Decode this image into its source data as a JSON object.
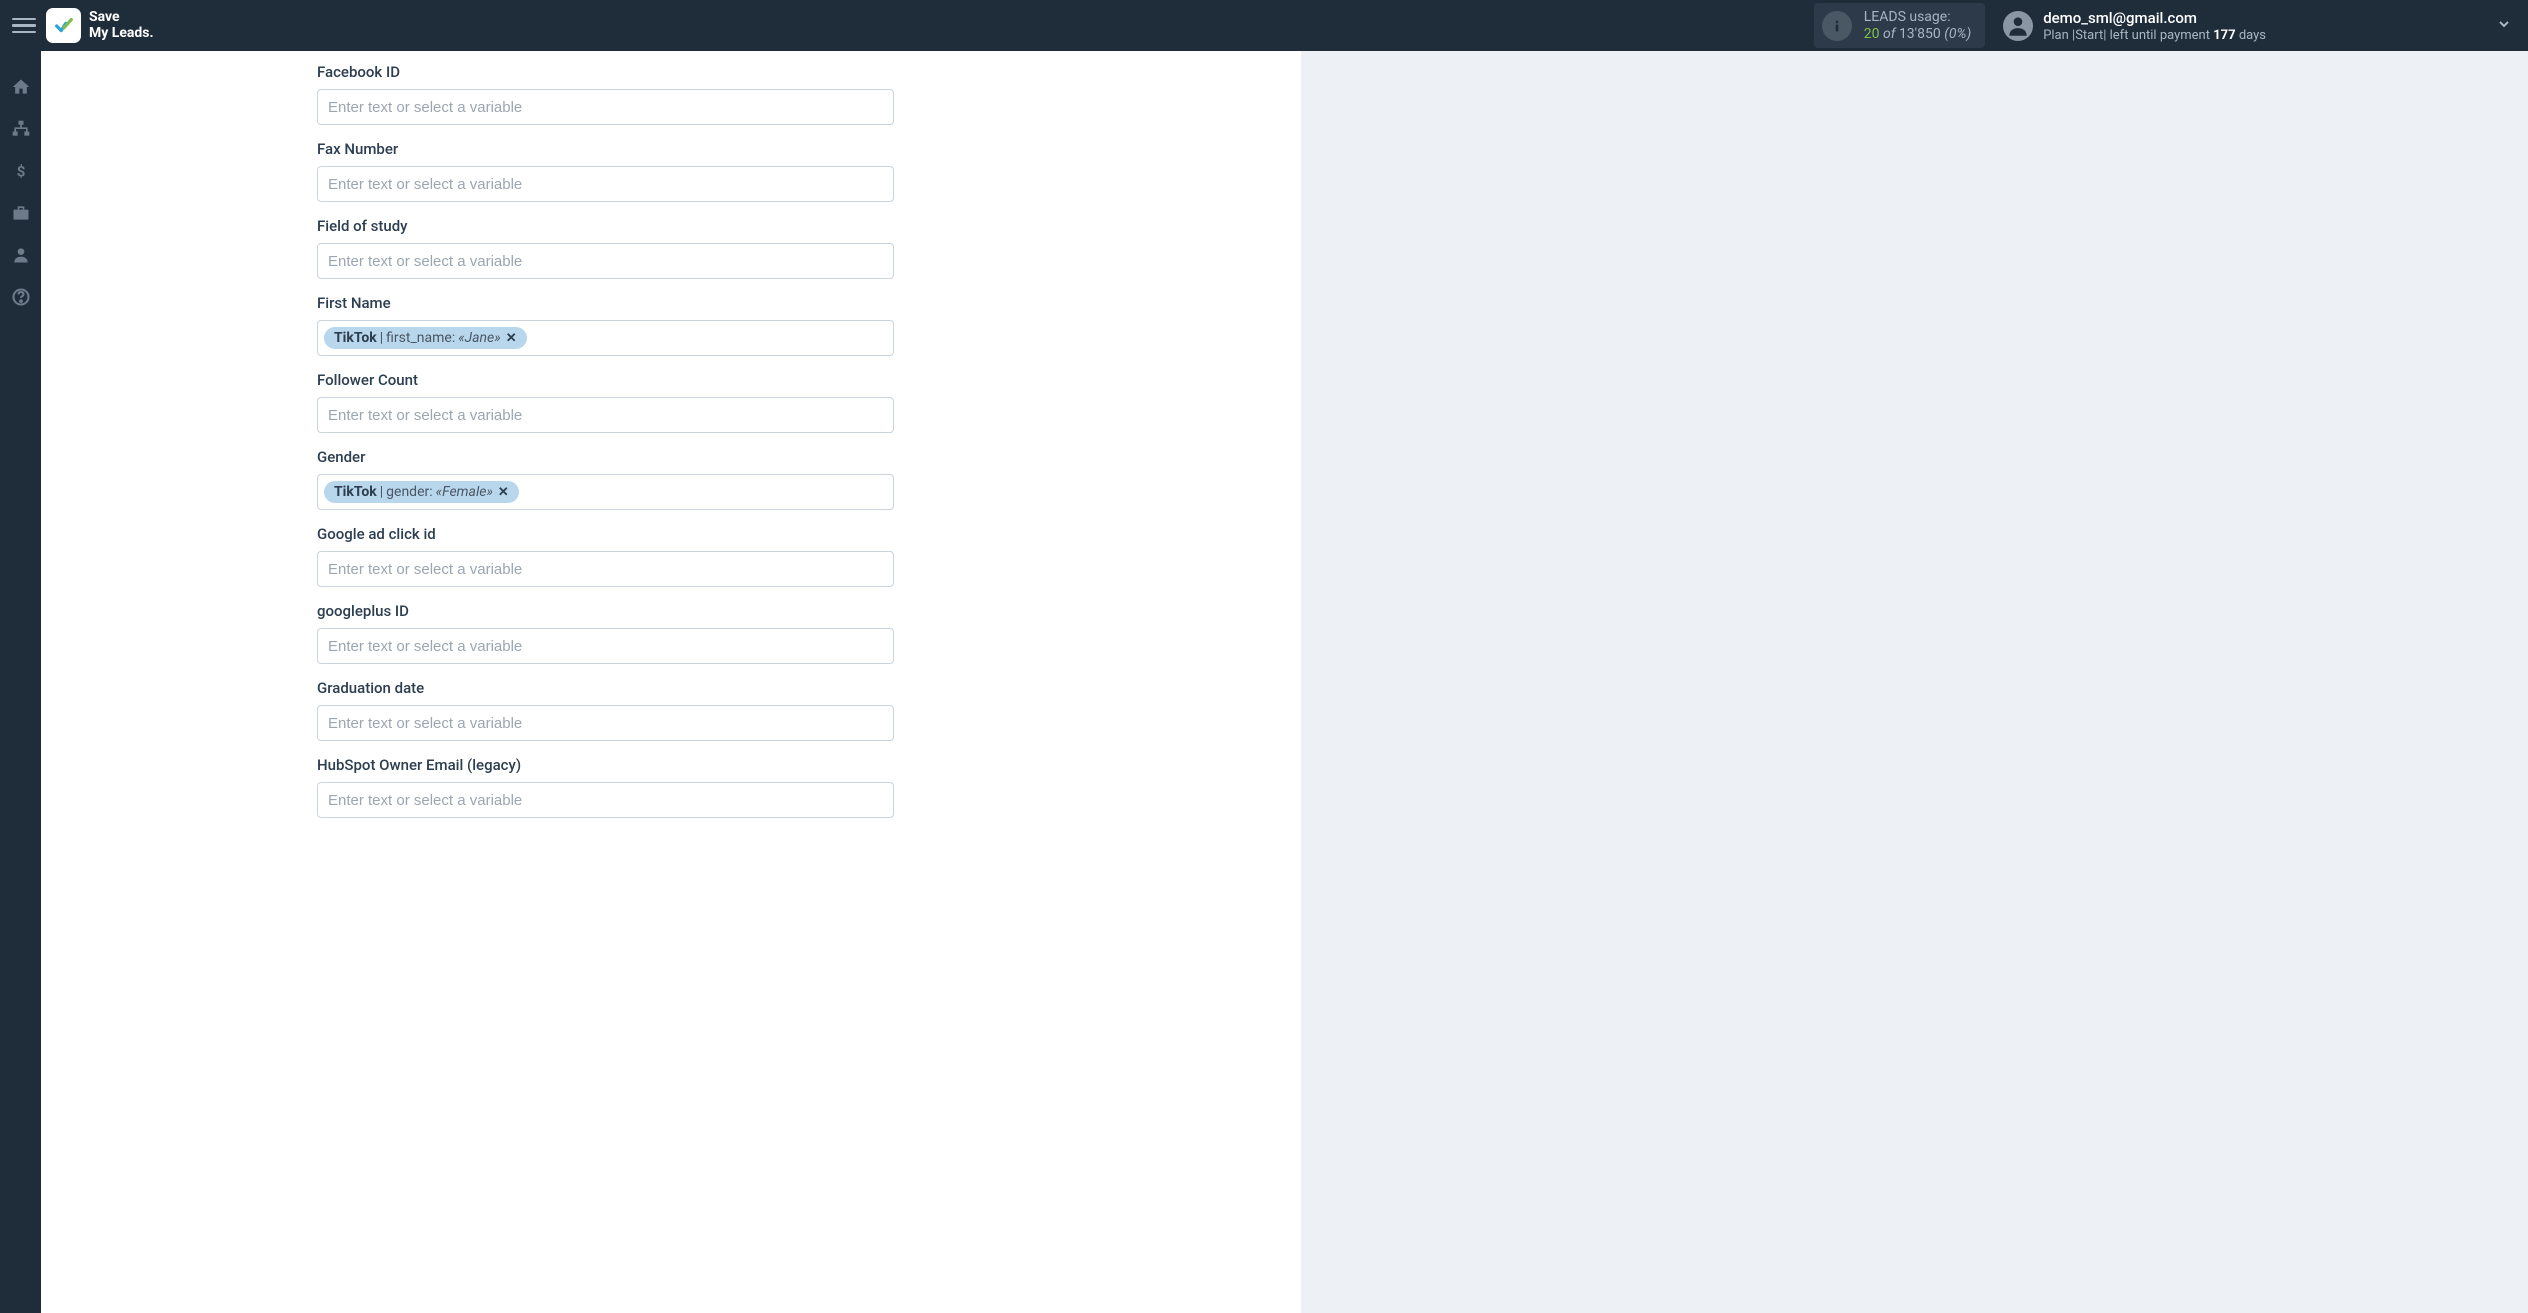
{
  "topbar": {
    "logo_line1": "Save",
    "logo_line2": "My Leads.",
    "usage": {
      "label": "LEADS usage:",
      "current": "20",
      "of": "of",
      "total": "13'850",
      "pct": "(0%)"
    },
    "user": {
      "email": "demo_sml@gmail.com",
      "plan_prefix": "Plan |Start| left until payment ",
      "plan_days_num": "177",
      "plan_days_word": " days"
    }
  },
  "form": {
    "placeholder": "Enter text or select a variable",
    "fields": [
      {
        "label": "Facebook ID"
      },
      {
        "label": "Fax Number"
      },
      {
        "label": "Field of study"
      },
      {
        "label": "First Name",
        "chip": {
          "source": "TikTok",
          "field": "first_name:",
          "value": "«Jane»"
        }
      },
      {
        "label": "Follower Count"
      },
      {
        "label": "Gender",
        "chip": {
          "source": "TikTok",
          "field": "gender:",
          "value": "«Female»"
        }
      },
      {
        "label": "Google ad click id"
      },
      {
        "label": "googleplus ID"
      },
      {
        "label": "Graduation date"
      },
      {
        "label": "HubSpot Owner Email (legacy)"
      }
    ]
  }
}
